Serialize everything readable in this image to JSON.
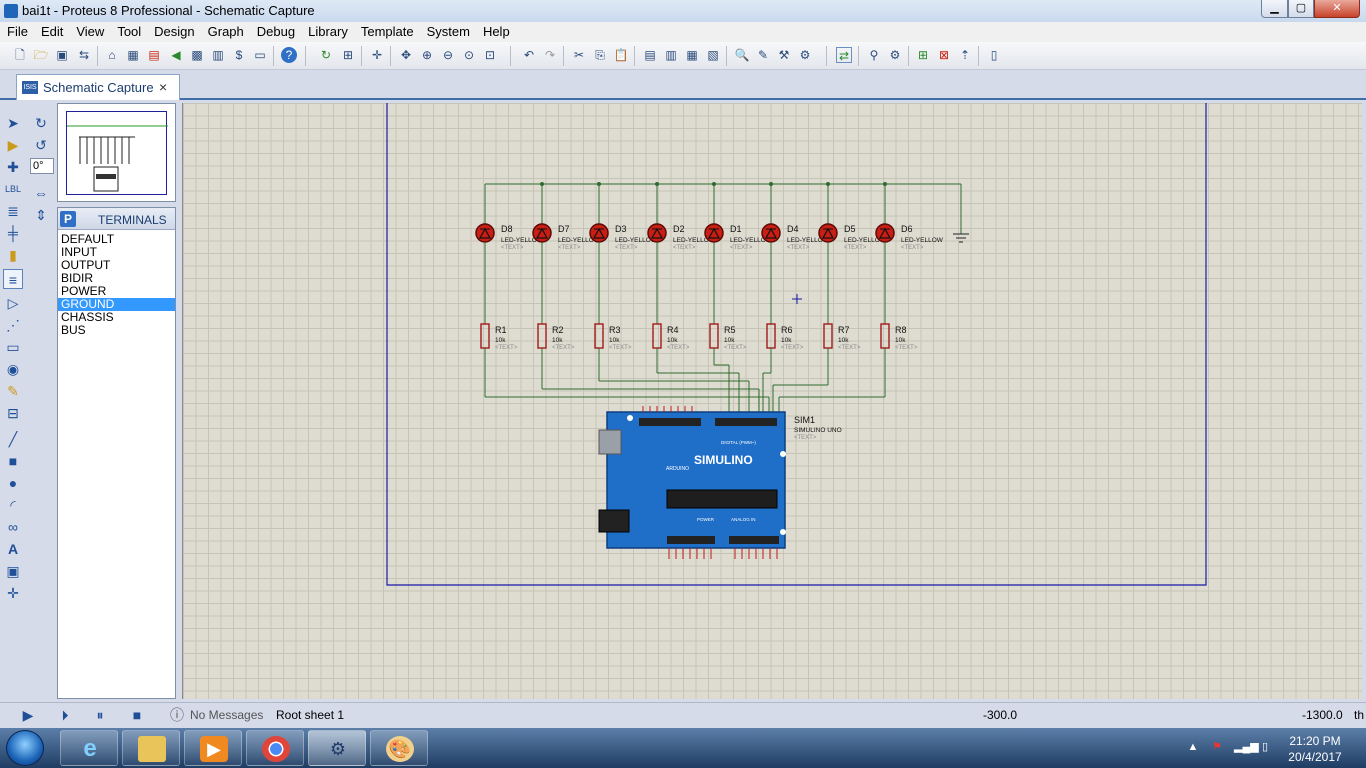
{
  "window": {
    "title": "bai1t - Proteus 8 Professional - Schematic Capture"
  },
  "menu": [
    "File",
    "Edit",
    "View",
    "Tool",
    "Design",
    "Graph",
    "Debug",
    "Library",
    "Template",
    "System",
    "Help"
  ],
  "tab": {
    "label": "Schematic Capture",
    "close": "×"
  },
  "rotation": {
    "angle": "0°"
  },
  "terminals": {
    "mode_button": "P",
    "title": "TERMINALS",
    "items": [
      "DEFAULT",
      "INPUT",
      "OUTPUT",
      "BIDIR",
      "POWER",
      "GROUND",
      "CHASSIS",
      "BUS"
    ],
    "selected": "GROUND"
  },
  "schematic": {
    "leds": [
      {
        "ref": "D8",
        "value": "LED-YELLOW",
        "text": "<TEXT>"
      },
      {
        "ref": "D7",
        "value": "LED-YELLOW",
        "text": "<TEXT>"
      },
      {
        "ref": "D3",
        "value": "LED-YELLOW",
        "text": "<TEXT>"
      },
      {
        "ref": "D2",
        "value": "LED-YELLOW",
        "text": "<TEXT>"
      },
      {
        "ref": "D1",
        "value": "LED-YELLOW",
        "text": "<TEXT>"
      },
      {
        "ref": "D4",
        "value": "LED-YELLOW",
        "text": "<TEXT>"
      },
      {
        "ref": "D5",
        "value": "LED-YELLOW",
        "text": "<TEXT>"
      },
      {
        "ref": "D6",
        "value": "LED-YELLOW",
        "text": "<TEXT>"
      }
    ],
    "resistors": [
      {
        "ref": "R1",
        "value": "10k",
        "text": "<TEXT>"
      },
      {
        "ref": "R2",
        "value": "10k",
        "text": "<TEXT>"
      },
      {
        "ref": "R3",
        "value": "10k",
        "text": "<TEXT>"
      },
      {
        "ref": "R4",
        "value": "10k",
        "text": "<TEXT>"
      },
      {
        "ref": "R5",
        "value": "10k",
        "text": "<TEXT>"
      },
      {
        "ref": "R6",
        "value": "10k",
        "text": "<TEXT>"
      },
      {
        "ref": "R7",
        "value": "10k",
        "text": "<TEXT>"
      },
      {
        "ref": "R8",
        "value": "10k",
        "text": "<TEXT>"
      }
    ],
    "board": {
      "ref": "SIM1",
      "value": "SIMULINO UNO",
      "text": "<TEXT>",
      "logo": "SIMULINO",
      "sublogo": "ARDUINO",
      "power_label": "POWER",
      "analog_label": "ANALOG IN",
      "digital_label": "DIGITAL (PWM~)"
    }
  },
  "status": {
    "messages": "No Messages",
    "sheet": "Root sheet 1",
    "x": "-300.0",
    "y": "-1300.0",
    "unit": "th"
  },
  "clock": {
    "time": "21:20 PM",
    "date": "20/4/2017"
  },
  "colors": {
    "wire": "#2e6b2e",
    "led": "#c81e14",
    "resistor": "#a11b1b",
    "board": "#1f6fc8",
    "sheet_border": "#1a1aa8",
    "grid": "#dedcd0"
  }
}
